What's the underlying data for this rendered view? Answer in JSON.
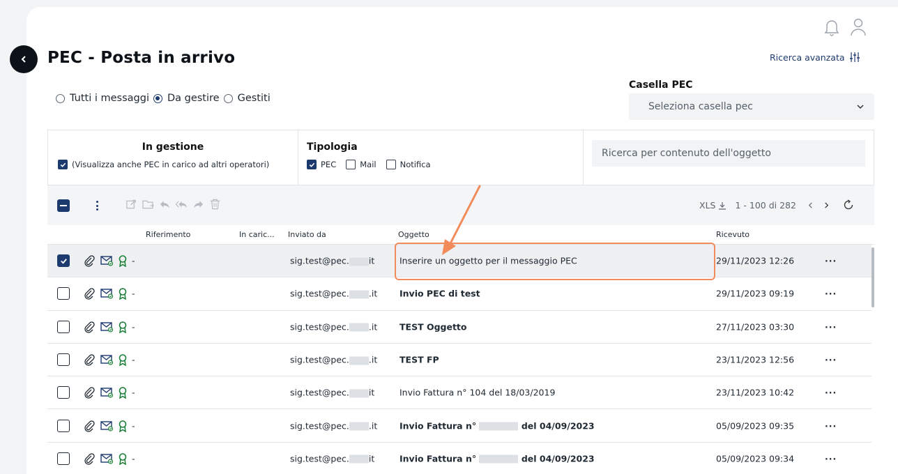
{
  "page": {
    "title": "PEC - Posta in arrivo",
    "advanced_search": "Ricerca avanzata"
  },
  "filters": {
    "radios": [
      {
        "label": "Tutti i messaggi",
        "checked": false
      },
      {
        "label": "Da gestire",
        "checked": true
      },
      {
        "label": "Gestiti",
        "checked": false
      }
    ],
    "casella_label": "Casella PEC",
    "casella_placeholder": "Seleziona casella pec",
    "in_gestione_title": "In gestione",
    "in_gestione_option": "(Visualizza anche PEC in carico ad altri operatori)",
    "tipologia_title": "Tipologia",
    "tipologia_options": [
      {
        "label": "PEC",
        "checked": true
      },
      {
        "label": "Mail",
        "checked": false
      },
      {
        "label": "Notifica",
        "checked": false
      }
    ],
    "search_placeholder": "Ricerca per contenuto dell'oggetto"
  },
  "toolbar": {
    "xls_label": "XLS",
    "range": "1 - 100 di 282"
  },
  "table": {
    "columns": {
      "riferimento": "Riferimento",
      "in_carico": "In caric...",
      "inviato_da": "Inviato da",
      "oggetto": "Oggetto",
      "ricevuto": "Ricevuto"
    },
    "rows": [
      {
        "ref": "-",
        "from_a": "sig.test@pec.",
        "from_b": "it",
        "subject": "Inserire un oggetto per il messaggio PEC",
        "received": "29/11/2023 12:26",
        "selected": true,
        "bold": false
      },
      {
        "ref": "-",
        "from_a": "sig.test@pec.",
        "from_b": ".it",
        "subject": "Invio PEC di test",
        "received": "29/11/2023 09:19",
        "selected": false,
        "bold": true
      },
      {
        "ref": "-",
        "from_a": "sig.test@pec.",
        "from_b": ".it",
        "subject": "TEST Oggetto",
        "received": "27/11/2023 03:30",
        "selected": false,
        "bold": true
      },
      {
        "ref": "-",
        "from_a": "sig.test@pec.",
        "from_b": ".it",
        "subject": "TEST FP",
        "received": "23/11/2023 12:56",
        "selected": false,
        "bold": true
      },
      {
        "ref": "-",
        "from_a": "sig.test@pec.",
        "from_b": "it",
        "subject": "Invio Fattura n° 104 del 18/03/2019",
        "received": "23/11/2023 10:42",
        "selected": false,
        "bold": false
      },
      {
        "ref": "-",
        "from_a": "sig.test@pec.",
        "from_b": ".it",
        "subject_a": "Invio Fattura n°",
        "subject_b": "del 04/09/2023",
        "received": "05/09/2023 09:35",
        "selected": false,
        "bold": true
      },
      {
        "ref": "-",
        "from_a": "sig.test@pec.",
        "from_b": "it",
        "subject_a": "Invio Fattura n°",
        "subject_b": "del 04/09/2023",
        "received": "05/09/2023 09:34",
        "selected": false,
        "bold": true
      }
    ],
    "more_label": "···"
  },
  "colors": {
    "accent": "#1d3a6e",
    "highlight": "#f28a59",
    "cert_green": "#1a7f37"
  }
}
